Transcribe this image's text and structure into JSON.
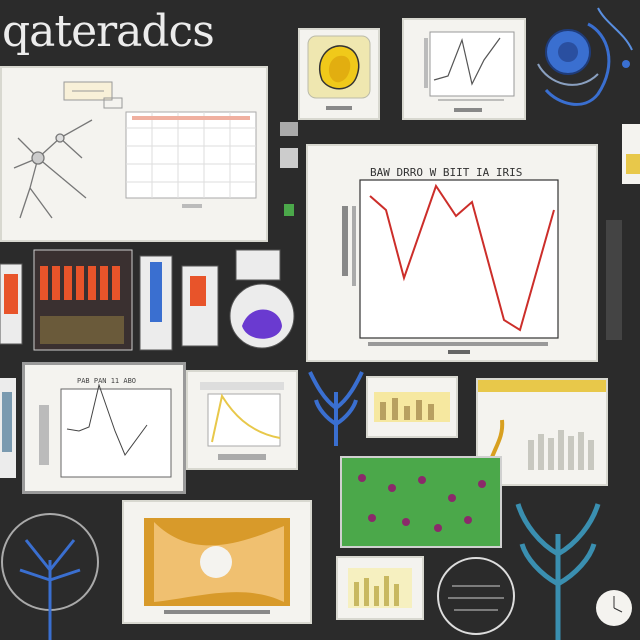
{
  "header": {
    "title": "qateradcs"
  },
  "main_chart": {
    "title": "BAW DRRO W BIIT IA IRIS",
    "color": "#cc2e2a"
  },
  "small_chart": {
    "title": "PAB PAN 11 ABO"
  },
  "colors": {
    "background": "#2b2b2b",
    "panel": "#f4f3ef",
    "red_line": "#cc2e2a",
    "orange": "#e8542a",
    "green": "#4ba84a",
    "yellow": "#e8c84a",
    "blue": "#3a6fd0"
  }
}
